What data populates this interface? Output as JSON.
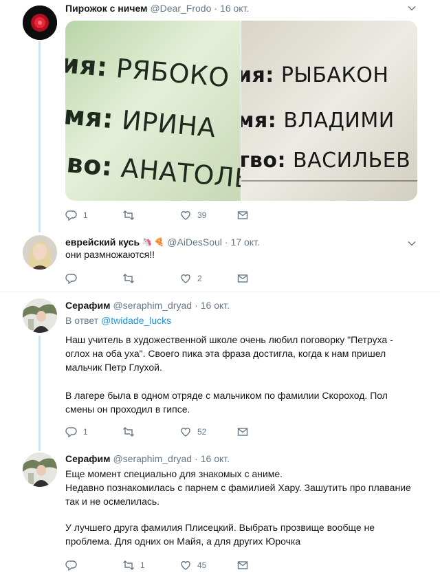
{
  "tweets": [
    {
      "name": "Пирожок с ничем",
      "handle": "@Dear_Frodo",
      "dot": "·",
      "date": "16 окт.",
      "photo_left": {
        "line1_bold": "ия:",
        "line1": "РЯБОКО",
        "line2_bold": "мя:",
        "line2": "ИРИНА",
        "line3_bold": "во:",
        "line3": "АНАТОЛЬ"
      },
      "photo_right": {
        "line1_bold": "ия:",
        "line1": "РЫБАКОН",
        "line2_bold": "мя:",
        "line2": "ВЛАДИМИ",
        "line3_bold": "тво:",
        "line3": "ВАСИЛЬЕВ"
      },
      "replies": "1",
      "retweets": "",
      "likes": "39"
    },
    {
      "name": "еврейский кусь",
      "emoji": "🦄 🍕",
      "handle": "@AiDesSoul",
      "dot": "·",
      "date": "17 окт.",
      "text": "они размножаются!!",
      "replies": "",
      "retweets": "",
      "likes": "2"
    },
    {
      "name": "Серафим",
      "handle": "@seraphim_dryad",
      "dot": "·",
      "date": "16 окт.",
      "reply_prefix": "В ответ",
      "reply_target": "@twidade_lucks",
      "para1": "Наш учитель в художественной школе очень любил поговорку \"Петруха - оглох на оба уха\". Своего пика эта фраза достигла, когда к нам пришел мальчик Петр Глухой.",
      "para2": "В лагере была в одном отряде с мальчиком по фамилии Скороход. Пол смены он проходил в гипсе.",
      "replies": "1",
      "retweets": "",
      "likes": "52"
    },
    {
      "name": "Серафим",
      "handle": "@seraphim_dryad",
      "dot": "·",
      "date": "16 окт.",
      "para1": "Еще момент специально для знакомых с аниме.",
      "para2": "Недавно познакомилась с парнем с фамилией Хару. Зашутить про плавание так и не осмелилась.",
      "para3": "У лучшего друга фамилия Плисецкий. Выбрать прозвище вообще не проблема. Для одних он Майя, а для других Юрочка",
      "replies": "",
      "retweets": "1",
      "likes": "45"
    }
  ]
}
